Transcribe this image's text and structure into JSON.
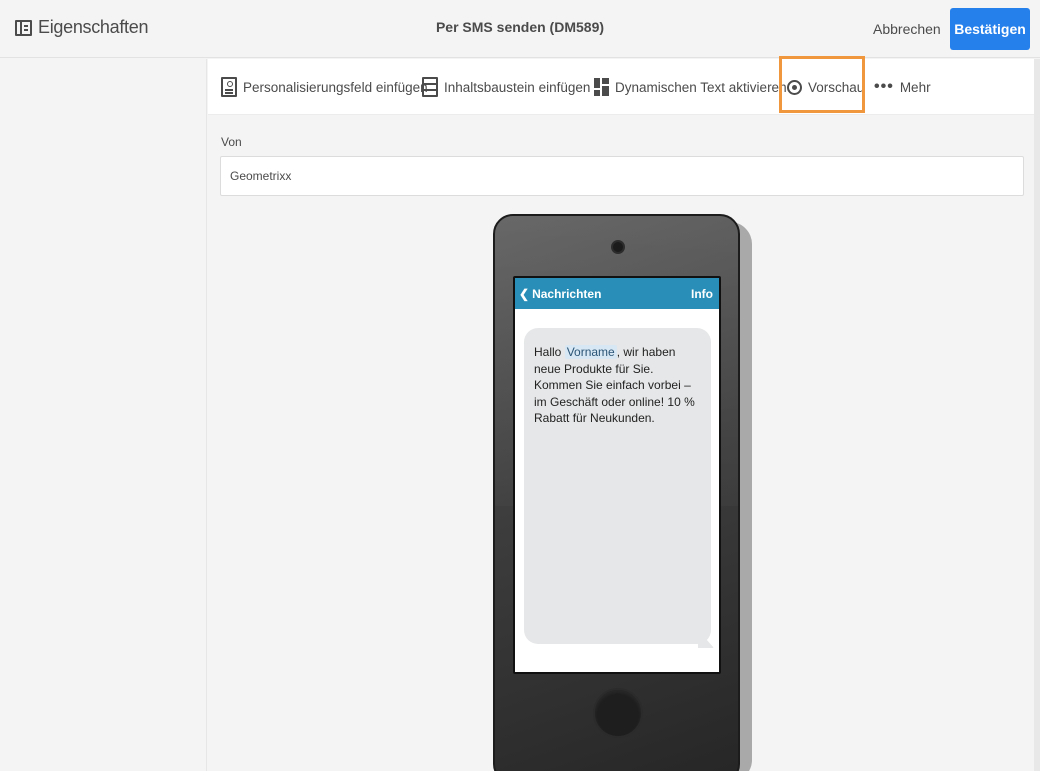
{
  "header": {
    "properties_label": "Eigenschaften",
    "title": "Per SMS senden (DM589)",
    "cancel_label": "Abbrechen",
    "confirm_label": "Bestätigen"
  },
  "toolbar": {
    "personalization_label": "Personalisierungsfeld einfügen",
    "content_block_label": "Inhaltsbaustein einfügen",
    "dynamic_text_label": "Dynamischen Text aktivieren",
    "preview_label": "Vorschau",
    "more_icon": "•••",
    "more_label": "Mehr"
  },
  "form": {
    "from_label": "Von",
    "from_value": "Geometrixx"
  },
  "phone": {
    "back_label": "Nachrichten",
    "info_label": "Info",
    "message_prefix": "Hallo ",
    "personalization_field": "Vorname",
    "message_suffix": ", wir haben neue Produkte für Sie. Kommen Sie einfach vorbei – im Geschäft oder online! 10 % Rabatt für Neukunden."
  },
  "colors": {
    "primary_button": "#2680eb",
    "highlight_box": "#f0963c",
    "sms_header": "#2a8fb8"
  }
}
